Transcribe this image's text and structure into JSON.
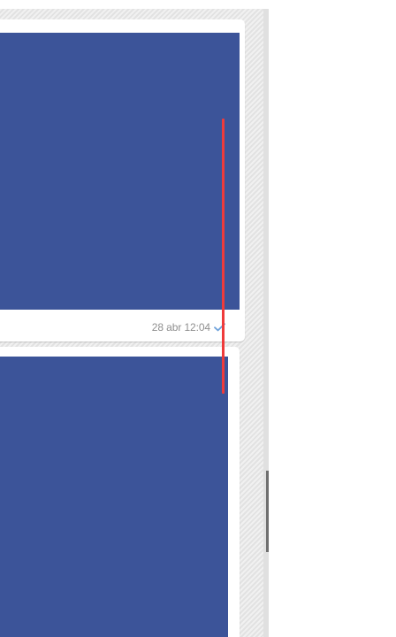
{
  "conversation": {
    "messages": [
      {
        "type": "image",
        "image_color": "#3c5499",
        "timestamp": "28 abr 12:04",
        "status_icon": "single-check-icon",
        "status_color": "#6fa2db"
      },
      {
        "type": "image",
        "image_color": "#3c5499"
      }
    ]
  },
  "annotation": {
    "color": "#ef3b3b"
  }
}
